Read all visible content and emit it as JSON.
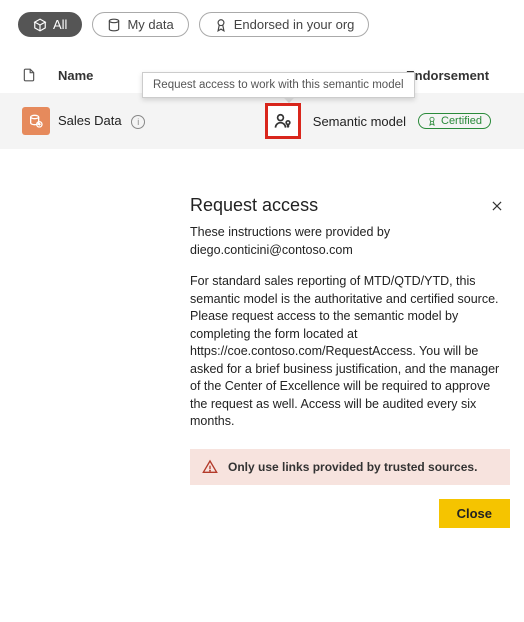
{
  "filters": {
    "all": "All",
    "mydata": "My data",
    "endorsed": "Endorsed in your org"
  },
  "columns": {
    "name": "Name",
    "endorsement": "Endorsement"
  },
  "tooltip": "Request access to work with this semantic model",
  "row": {
    "name": "Sales Data",
    "type": "Semantic model",
    "badge": "Certified"
  },
  "dialog": {
    "title": "Request access",
    "provided_by": "These instructions were provided by diego.conticini@contoso.com",
    "body": "For standard sales reporting of MTD/QTD/YTD, this semantic model is the authoritative and certified source. Please request access to the semantic model by completing the form located at https://coe.contoso.com/RequestAccess. You will be asked for a brief business justification, and the manager of the Center of Excellence will be required to approve the request as well. Access will be audited every six months.",
    "warning": "Only use links provided by trusted sources.",
    "close": "Close"
  }
}
